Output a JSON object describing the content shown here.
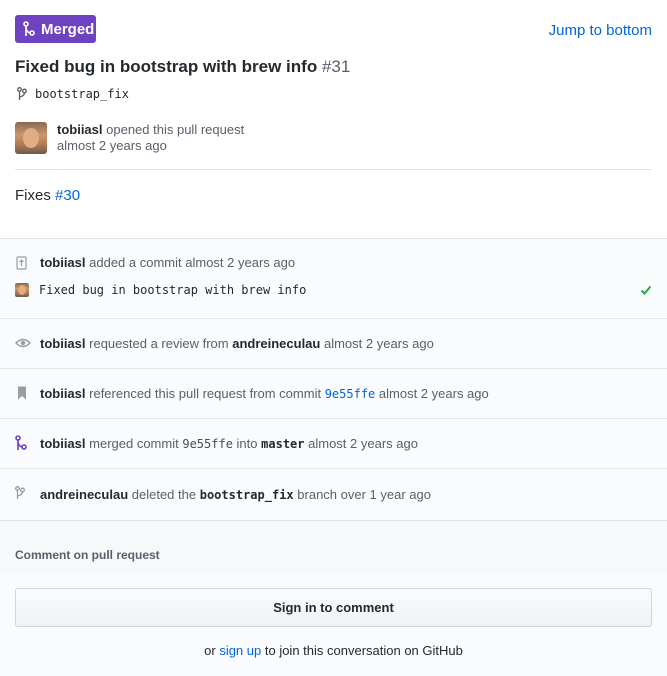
{
  "header": {
    "state_label": "Merged",
    "jump_label": "Jump to bottom",
    "title": "Fixed bug in bootstrap with brew info",
    "number": "#31",
    "branch": "bootstrap_fix",
    "author": "tobiiasl",
    "opened_text": "opened this pull request",
    "opened_time": "almost 2 years ago",
    "colors": {
      "merged": "#6f42c1",
      "link": "#0366d6",
      "success": "#28a745"
    }
  },
  "body": {
    "prefix": "Fixes",
    "issue_ref": "#30"
  },
  "timeline": {
    "commit_event": {
      "actor": "tobiiasl",
      "text": "added a commit almost 2 years ago",
      "commit_message": "Fixed bug in bootstrap with brew info"
    },
    "review_event": {
      "actor": "tobiiasl",
      "text_before": "requested a review from",
      "reviewer": "andreineculau",
      "time": "almost 2 years ago"
    },
    "reference_event": {
      "actor": "tobiiasl",
      "text_before": "referenced this pull request from commit",
      "sha": "9e55ffe",
      "time": "almost 2 years ago"
    },
    "merge_event": {
      "actor": "tobiiasl",
      "text_before": "merged commit",
      "sha": "9e55ffe",
      "text_into": "into",
      "target": "master",
      "time": "almost 2 years ago"
    },
    "delete_event": {
      "actor": "andreineculau",
      "text_before": "deleted the",
      "branch": "bootstrap_fix",
      "text_after": "branch over 1 year ago"
    }
  },
  "comment": {
    "header": "Comment on pull request",
    "sign_in_label": "Sign in to comment",
    "prefix": "or",
    "signup_link": "sign up",
    "suffix": "to join this conversation on GitHub"
  },
  "icons": [
    "merge-icon",
    "branch-icon",
    "commit-icon",
    "check-icon",
    "eye-icon",
    "bookmark-icon",
    "avatar"
  ]
}
